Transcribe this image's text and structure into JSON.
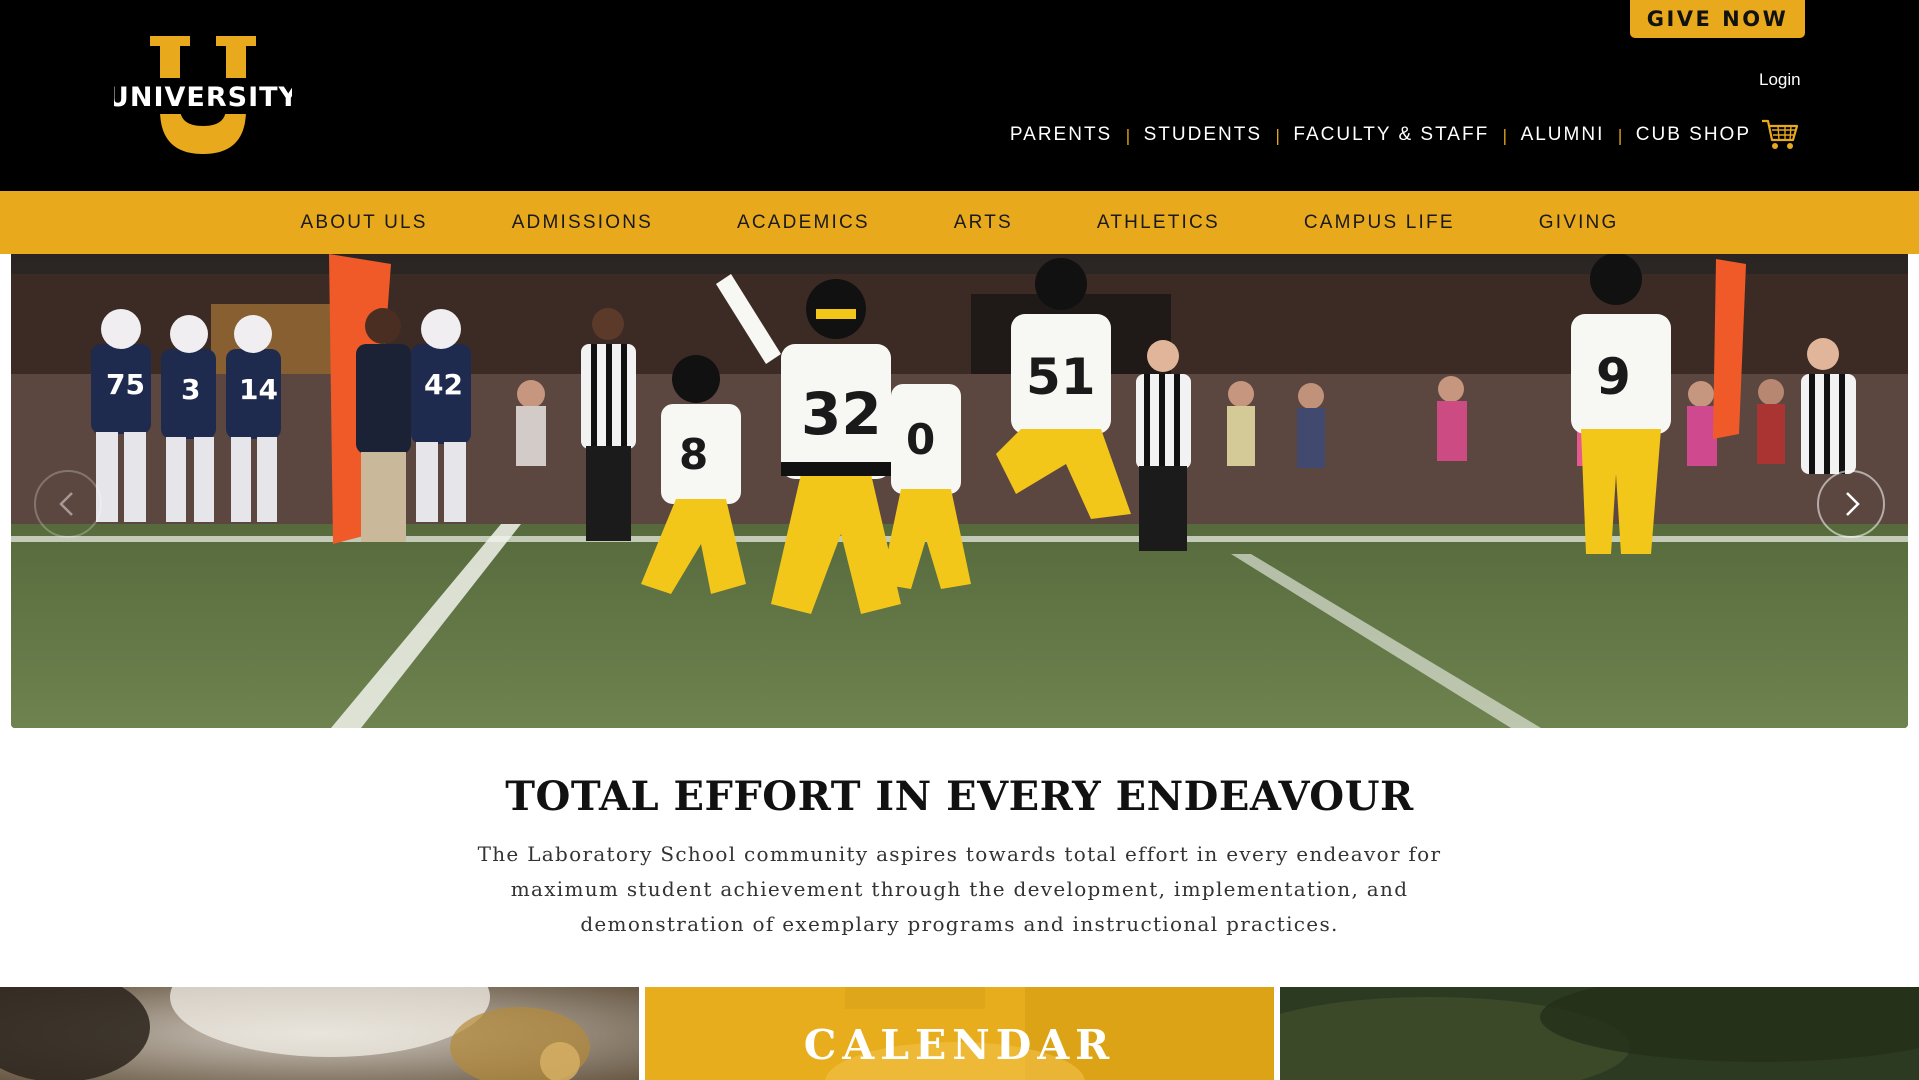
{
  "brand": {
    "logo_text": "UNIVERSITY",
    "logo_letter": "U",
    "gold": "#e8a91c",
    "black": "#000000"
  },
  "header": {
    "give_label": "GIVE NOW",
    "login_label": "Login",
    "audience_links": [
      "PARENTS",
      "STUDENTS",
      "FACULTY & STAFF",
      "ALUMNI",
      "CUB SHOP"
    ],
    "cart_icon": "shopping-cart-icon"
  },
  "main_nav": [
    "ABOUT ULS",
    "ADMISSIONS",
    "ACADEMICS",
    "ARTS",
    "ATHLETICS",
    "CAMPUS LIFE",
    "GIVING"
  ],
  "hero": {
    "image": "football-celebration-photo",
    "player_numbers": [
      "32",
      "51",
      "9",
      "8",
      "0"
    ],
    "opponent_numbers": [
      "75",
      "3",
      "14",
      "42"
    ],
    "prev_icon": "chevron-left-icon",
    "next_icon": "chevron-right-icon"
  },
  "mission": {
    "title": "TOTAL EFFORT IN EVERY ENDEAVOUR",
    "line1": "The Laboratory School community aspires towards total effort in every endeavor for",
    "line2": "maximum student achievement through the development, implementation, and",
    "line3": "demonstration of exemplary programs and instructional practices."
  },
  "tiles": {
    "middle_label": "CALENDAR"
  }
}
